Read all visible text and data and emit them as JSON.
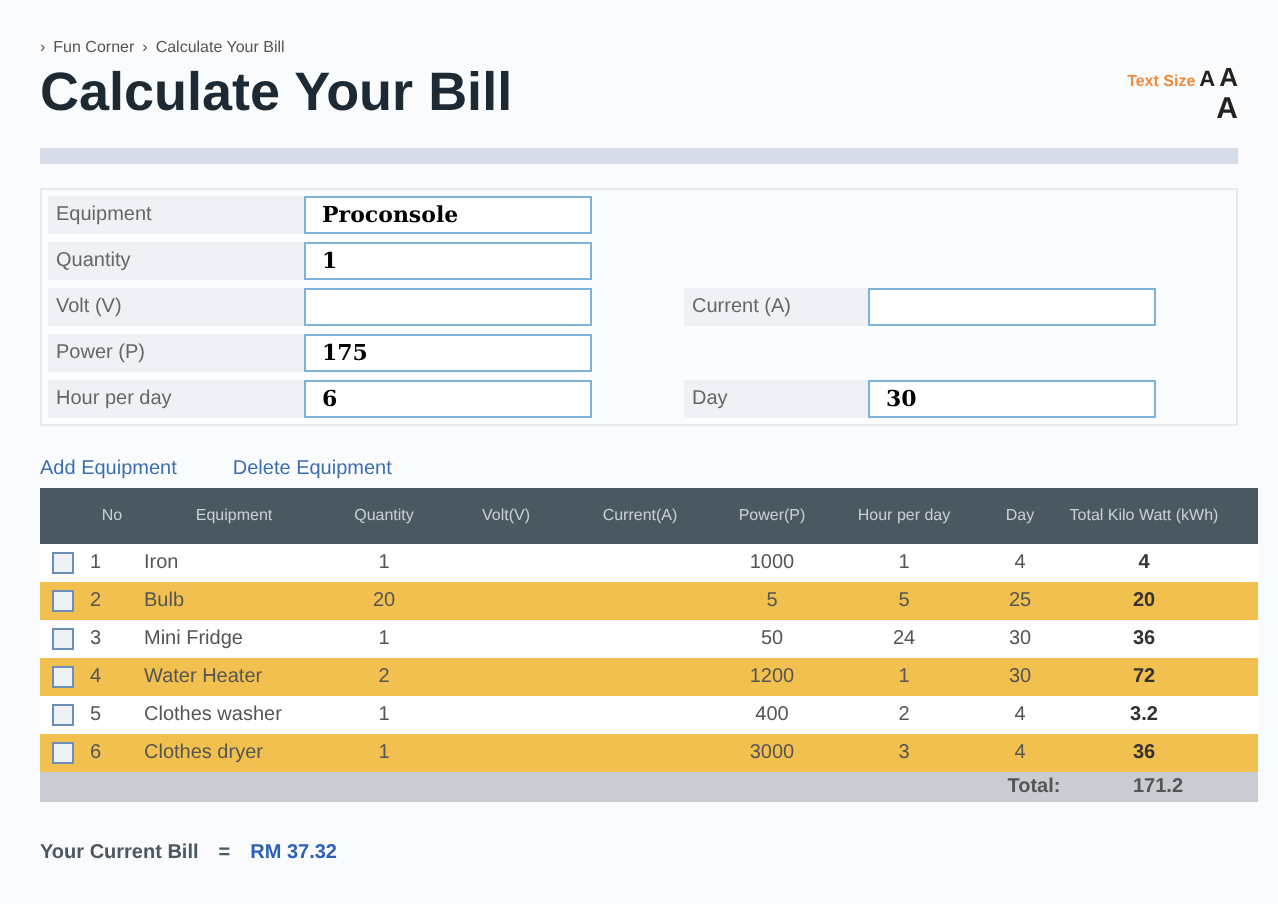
{
  "breadcrumb": [
    {
      "sep": "›",
      "label": "Fun Corner"
    },
    {
      "sep": "›",
      "label": "Calculate Your Bill"
    }
  ],
  "title": "Calculate Your Bill",
  "text_size": {
    "label": "Text Size",
    "options": [
      "A",
      "A",
      "A"
    ]
  },
  "form": {
    "left": [
      {
        "label": "Equipment",
        "value": "Proconsole"
      },
      {
        "label": "Quantity",
        "value": "1"
      },
      {
        "label": "Volt (V)"
      },
      {
        "label": "Power (P)",
        "value": "175"
      },
      {
        "label": "Hour per day",
        "value": "6"
      }
    ],
    "right": [
      {
        "label": "Current (A)"
      },
      {
        "label": "Day",
        "value": "30"
      }
    ]
  },
  "links": [
    "Add Equipment",
    "Delete Equipment"
  ],
  "table": {
    "columns": [
      "No",
      "Equipment",
      "Quantity",
      "Volt(V)",
      "Current(A)",
      "Power(P)",
      "Hour per day",
      "Day",
      "Total Kilo Watt (kWh)"
    ],
    "rows": [
      {
        "checked": false,
        "cells": [
          "1",
          "Iron",
          "1",
          null,
          null,
          "1000",
          "1",
          "4",
          "4"
        ]
      },
      {
        "checked": false,
        "cells": [
          "2",
          "Bulb",
          "20",
          null,
          null,
          "5",
          "5",
          "25",
          "20"
        ]
      },
      {
        "checked": false,
        "cells": [
          "3",
          "Mini Fridge",
          "1",
          null,
          null,
          "50",
          "24",
          "30",
          "36"
        ]
      },
      {
        "checked": false,
        "cells": [
          "4",
          "Water Heater",
          "2",
          null,
          null,
          "1200",
          "1",
          "30",
          "72"
        ]
      },
      {
        "checked": false,
        "cells": [
          "5",
          "Clothes washer",
          "1",
          null,
          null,
          "400",
          "2",
          "4",
          "3.2"
        ]
      },
      {
        "checked": false,
        "cells": [
          "6",
          "Clothes dryer",
          "1",
          null,
          null,
          "3000",
          "3",
          "4",
          "36"
        ]
      }
    ],
    "total_label": "Total:",
    "total_value": "171.2"
  },
  "bill": {
    "label": "Your Current Bill",
    "equals": "=",
    "value": "RM 37.32"
  }
}
